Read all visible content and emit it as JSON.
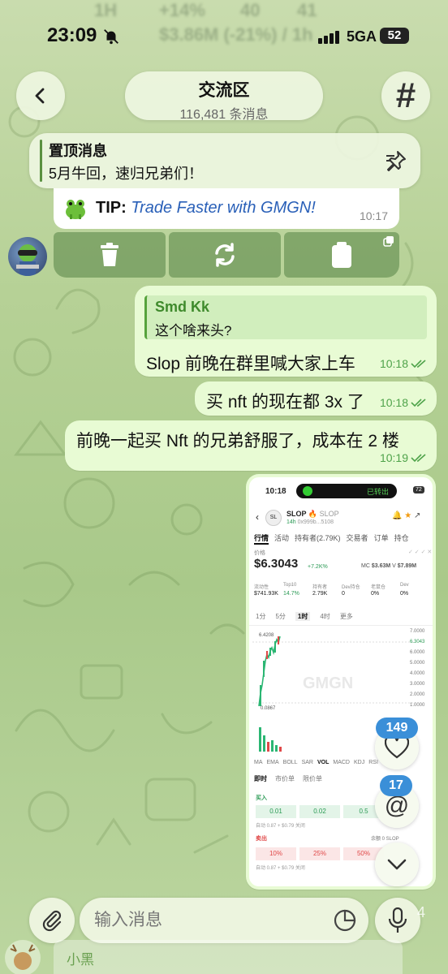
{
  "status": {
    "time": "23:09",
    "network": "5GA",
    "battery": "52"
  },
  "background_text": [
    "1H",
    "+14%",
    "40",
    "41",
    "$3.86M (-21%) / 1h"
  ],
  "header": {
    "title": "交流区",
    "subtitle": "116,481 条消息"
  },
  "pinned": {
    "title": "置顶消息",
    "text": "5月牛回，速归兄弟们！"
  },
  "tip": {
    "prefix": "TIP",
    "text": "Trade Faster with GMGN!",
    "time": "10:17"
  },
  "messages": [
    {
      "reply_name": "Smd Kk",
      "reply_text": "这个啥来头?",
      "text": "Slop 前晚在群里喊大家上车",
      "time": "10:18"
    },
    {
      "text": "买 nft 的现在都 3x 了",
      "time": "10:18"
    },
    {
      "text": "前晚一起买 Nft 的兄弟舒服了，成本在 2 楼",
      "time": "10:19"
    }
  ],
  "screenshot": {
    "time": "10:18",
    "token": "SLOP",
    "token_sub": "SLOP",
    "age": "14h",
    "address": "0x999b...5108",
    "tabs": [
      "行情",
      "活动",
      "持有者(2.79K)",
      "交易者",
      "订单",
      "持仓"
    ],
    "price_label": "价格",
    "price": "$6.3043",
    "change": "+7.2K%",
    "mc": "$3.63M",
    "vol": "$7.89M",
    "stats_labels": [
      "流动性",
      "Top10",
      "持有者",
      "Dev持仓",
      "老鼠仓",
      "Dev"
    ],
    "stats_values": [
      "$741.93K",
      "14.7%",
      "2.79K",
      "0",
      "0%",
      "0%"
    ],
    "intervals": [
      "1分",
      "5分",
      "1时",
      "4时",
      "更多"
    ],
    "chart_high": "6.4208",
    "chart_low": "0.0867",
    "axis_values": [
      "7.0000",
      "6.3043",
      "6.0000",
      "5.0000",
      "4.0000",
      "3.0000",
      "2.0000",
      "1.0000"
    ],
    "watermark": "GMGN",
    "indicators": [
      "MA",
      "EMA",
      "BOLL",
      "SAR",
      "VOL",
      "MACD",
      "KDJ",
      "RSI"
    ],
    "order_tabs": [
      "即时",
      "市价单",
      "限价单"
    ],
    "buy_label": "买入",
    "buy_amounts": [
      "0.01",
      "0.02",
      "0.5"
    ],
    "sell_label": "卖出",
    "sell_balance": "余额 0 SLOP",
    "sell_pcts": [
      "10%",
      "25%",
      "50%"
    ],
    "auto_text": "自动  0.87 + $0.79  关闭",
    "status_pill": "已转出",
    "battery_small": "72"
  },
  "floating": {
    "likes": "149",
    "mentions": "17"
  },
  "input": {
    "placeholder": "输入消息",
    "mic_count": "4"
  },
  "bottom": {
    "name": "小黑"
  }
}
